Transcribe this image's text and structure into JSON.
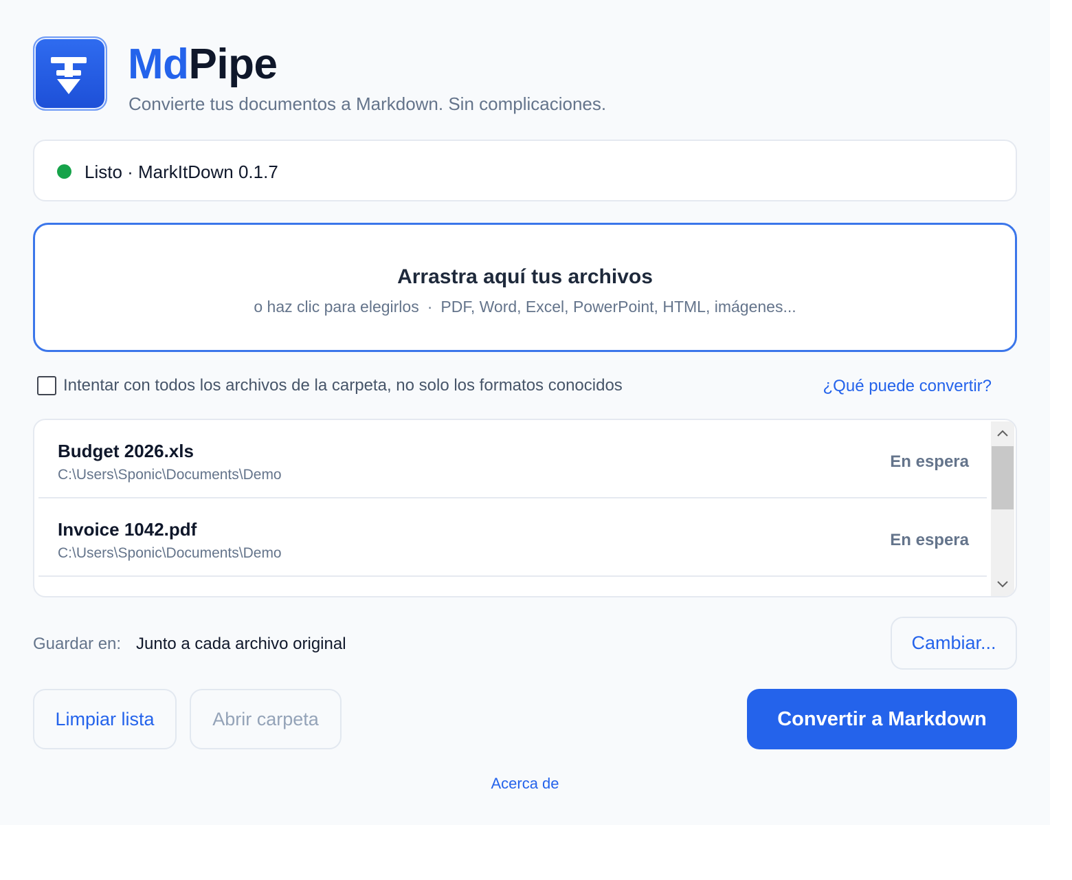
{
  "app": {
    "title_part1": "Md",
    "title_part2": "Pipe",
    "subtitle": "Convierte tus documentos a Markdown. Sin complicaciones.",
    "logo_icon": "download-arrow-icon",
    "accent_color": "#2463eb"
  },
  "status": {
    "text": "Listo · MarkItDown 0.1.7",
    "dot_color": "#16a34a"
  },
  "dropzone": {
    "title": "Arrastra aquí tus archivos",
    "hint": "o haz clic para elegirlos",
    "separator": "·",
    "formats": "PDF, Word, Excel, PowerPoint, HTML, imágenes..."
  },
  "options": {
    "all_files_label": "Intentar con todos los archivos de la carpeta, no solo los formatos conocidos",
    "all_files_checked": false,
    "help_link": "¿Qué puede convertir?"
  },
  "files": [
    {
      "name": "Budget 2026.xls",
      "path": "C:\\Users\\Sponic\\Documents\\Demo",
      "status": "En espera"
    },
    {
      "name": "Invoice 1042.pdf",
      "path": "C:\\Users\\Sponic\\Documents\\Demo",
      "status": "En espera"
    }
  ],
  "save": {
    "label": "Guardar en:",
    "value": "Junto a cada archivo original",
    "change_button": "Cambiar..."
  },
  "actions": {
    "clear": "Limpiar lista",
    "open_folder": "Abrir carpeta",
    "convert": "Convertir a Markdown"
  },
  "footer": {
    "about": "Acerca de"
  }
}
